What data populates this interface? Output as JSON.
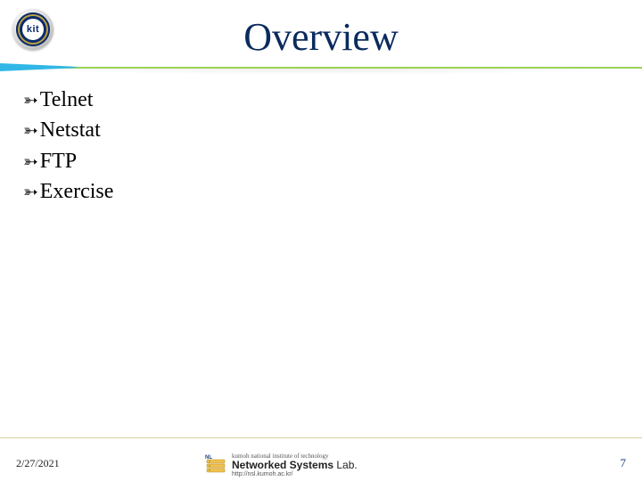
{
  "header": {
    "title": "Overview",
    "logo_text": "kit"
  },
  "bullets": [
    {
      "label": "Telnet"
    },
    {
      "label": "Netstat"
    },
    {
      "label": "FTP"
    },
    {
      "label": "Exercise"
    }
  ],
  "footer": {
    "date": "2/27/2021",
    "page": "7",
    "lab_sup": "kumoh national institute of technology",
    "lab_main_bold": "Networked Systems",
    "lab_main_rest": " Lab.",
    "lab_url": "http://nsl.kumoh.ac.kr/"
  },
  "colors": {
    "title": "#0b2a5e",
    "rule": "#79c21d",
    "accent": "#31b7e6"
  }
}
